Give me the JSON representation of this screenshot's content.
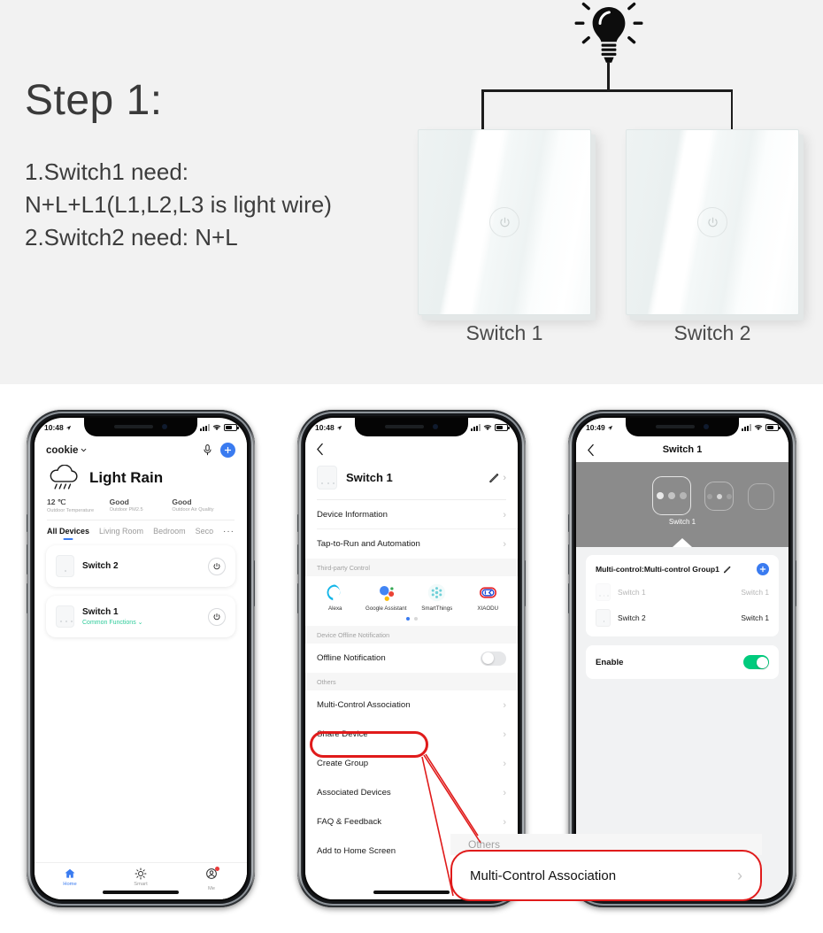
{
  "top": {
    "step_title": "Step 1:",
    "requirements": [
      "1.Switch1 need:",
      "N+L+L1(L1,L2,L3 is light wire)",
      "2.Switch2 need: N+L"
    ],
    "bulb_icon": "light-bulb-icon",
    "switches": [
      {
        "label": "Switch 1",
        "key_icon": "power-touch-icon"
      },
      {
        "label": "Switch 2",
        "key_icon": "power-touch-icon"
      }
    ]
  },
  "phone1": {
    "status": {
      "time": "10:48",
      "location_icon": "location-arrow-icon",
      "signal_icon": "cellular-icon",
      "wifi_icon": "wifi-icon",
      "battery_icon": "battery-icon"
    },
    "home_name": "cookie",
    "home_chevron": "chevron-down-icon",
    "voice_icon": "microphone-icon",
    "add_icon": "plus-icon",
    "weather": {
      "icon": "rain-cloud-icon",
      "condition": "Light Rain",
      "stats": [
        {
          "value": "12 ℃",
          "label": "Outdoor Temperature"
        },
        {
          "value": "Good",
          "label": "Outdoor PM2.5"
        },
        {
          "value": "Good",
          "label": "Outdoor Air Quality"
        }
      ]
    },
    "tabs": [
      {
        "label": "All Devices",
        "active": true
      },
      {
        "label": "Living Room",
        "active": false
      },
      {
        "label": "Bedroom",
        "active": false
      },
      {
        "label": "Second",
        "active": false
      }
    ],
    "tabs_more": "···",
    "devices": [
      {
        "name": "Switch 2",
        "sub": "",
        "power_icon": "power-icon"
      },
      {
        "name": "Switch 1",
        "sub": "Common Functions",
        "sub_chevron": "chevron-down-icon",
        "power_icon": "power-icon"
      }
    ],
    "tabbar": [
      {
        "label": "Home",
        "icon": "home-icon",
        "active": true
      },
      {
        "label": "Smart",
        "icon": "sun-icon",
        "active": false
      },
      {
        "label": "Me",
        "icon": "account-icon",
        "active": false,
        "badge": true
      }
    ]
  },
  "phone2": {
    "status": {
      "time": "10:48"
    },
    "back_icon": "chevron-left-icon",
    "device": {
      "name": "Switch 1",
      "thumb_icon": "switch-panel-icon",
      "edit_icon": "pencil-icon",
      "chevron": "chevron-right-icon"
    },
    "rows_top": [
      {
        "label": "Device Information",
        "chevron": "chevron-right-icon"
      },
      {
        "label": "Tap-to-Run and Automation",
        "chevron": "chevron-right-icon"
      }
    ],
    "third_party_header": "Third-party Control",
    "third_party": [
      {
        "name": "Alexa",
        "icon": "alexa-icon",
        "color": "#14b6e8"
      },
      {
        "name": "Google Assistant",
        "icon": "google-assistant-icon",
        "color": "#4285f4"
      },
      {
        "name": "SmartThings",
        "icon": "smartthings-icon",
        "color": "#6fd0d8"
      },
      {
        "name": "XIAODU",
        "icon": "xiaodu-icon",
        "color": "#e8262a"
      }
    ],
    "pager": {
      "count": 2,
      "active": 0
    },
    "offline_header": "Device Offline Notification",
    "offline_row": {
      "label": "Offline Notification",
      "toggle": "off"
    },
    "others_header": "Others",
    "rows_others": [
      {
        "label": "Multi-Control Association",
        "chevron": "chevron-right-icon",
        "highlighted": true
      },
      {
        "label": "Share Device",
        "chevron": "chevron-right-icon"
      },
      {
        "label": "Create Group",
        "chevron": "chevron-right-icon"
      },
      {
        "label": "Associated Devices",
        "chevron": "chevron-right-icon"
      },
      {
        "label": "FAQ & Feedback",
        "chevron": "chevron-right-icon"
      },
      {
        "label": "Add to Home Screen",
        "chevron": "chevron-right-icon"
      }
    ]
  },
  "callout": {
    "others_label": "Others",
    "row_label": "Multi-Control Association",
    "chevron": "chevron-right-icon",
    "color": "#e01b1b"
  },
  "phone3": {
    "status": {
      "time": "10:49"
    },
    "back_icon": "chevron-left-icon",
    "title": "Switch 1",
    "hero": {
      "label": "Switch 1",
      "tiles": 3
    },
    "group": {
      "title": "Multi-control:Multi-control Group1",
      "edit_icon": "pencil-icon",
      "add_icon": "plus-icon",
      "rows": [
        {
          "device": "Switch 1",
          "channel": "Switch 1",
          "dimmed": true
        },
        {
          "device": "Switch 2",
          "channel": "Switch 1",
          "dimmed": false
        }
      ]
    },
    "enable": {
      "label": "Enable",
      "toggle": "on",
      "color": "#00cb7d"
    }
  },
  "colors": {
    "page_bg": "#ffffff",
    "top_bg": "#f2f2f2",
    "accent_blue": "#3a7bf0",
    "accent_green": "#00cb7d",
    "teal_text": "#2ecb9a",
    "callout_red": "#e01b1b",
    "hero_gray": "#8b8b8b"
  }
}
